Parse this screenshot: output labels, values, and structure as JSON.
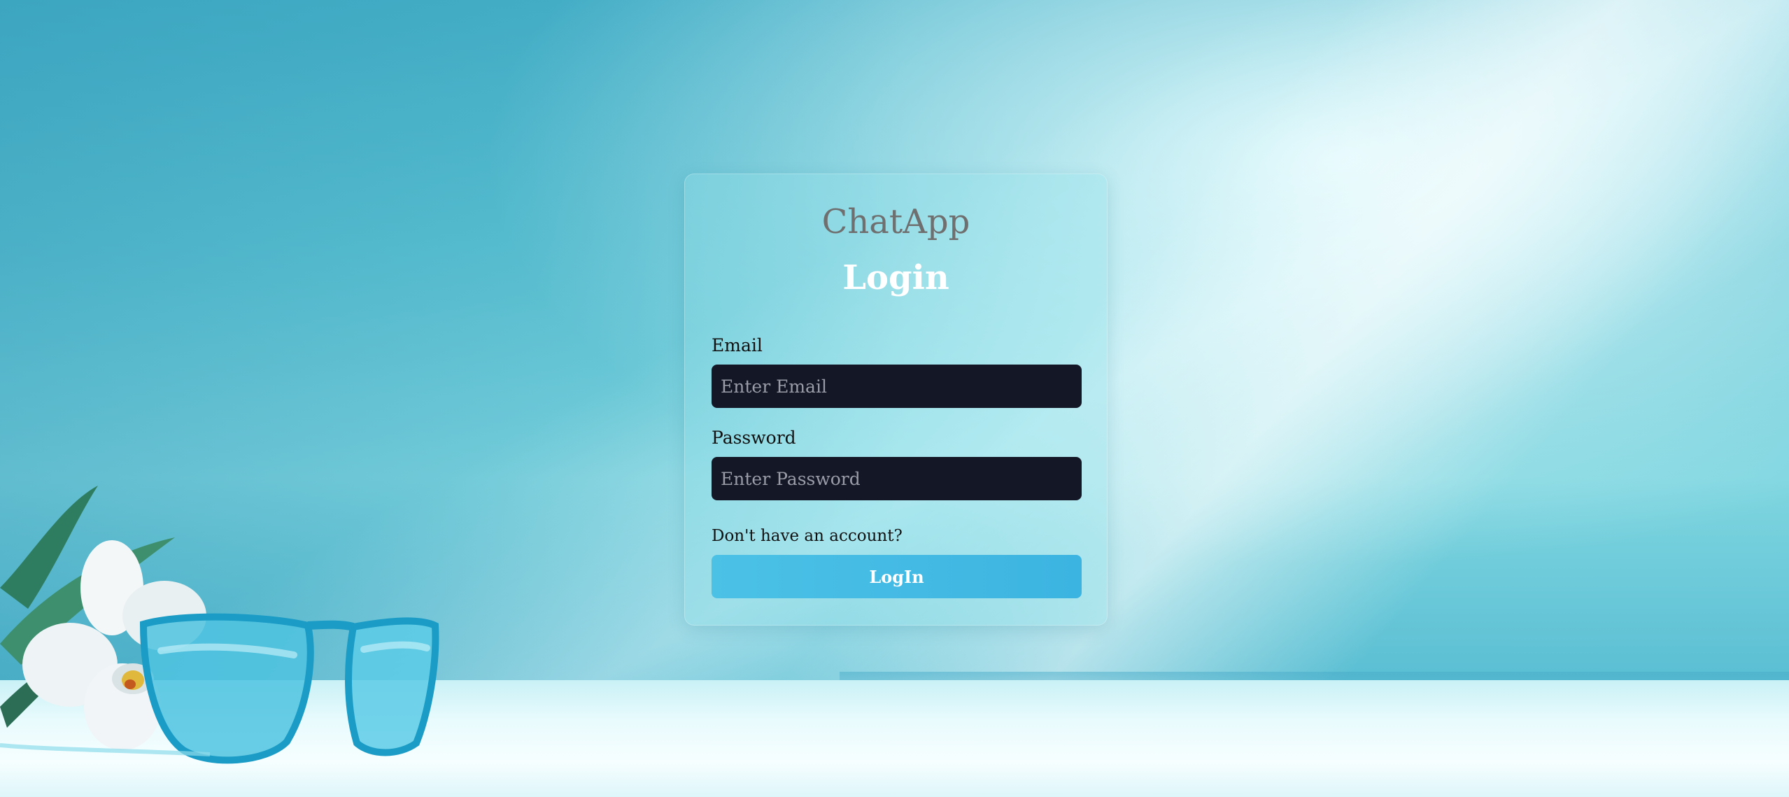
{
  "app": {
    "name": "ChatApp"
  },
  "form": {
    "heading": "Login",
    "email_label": "Email",
    "email_placeholder": "Enter Email",
    "email_value": "",
    "password_label": "Password",
    "password_placeholder": "Enter Password",
    "password_value": "",
    "signup_prompt": "Don't have an account?",
    "submit_label": "LogIn"
  },
  "decor": {
    "icons": [
      "orchid-flower-icon",
      "leaf-icon",
      "sunglasses-icon"
    ]
  },
  "colors": {
    "background_accent": "#5cc3d3",
    "input_background": "#141726",
    "button": "#45bde4",
    "brand_text": "#6f6f6f",
    "heading_text": "#ffffff"
  }
}
